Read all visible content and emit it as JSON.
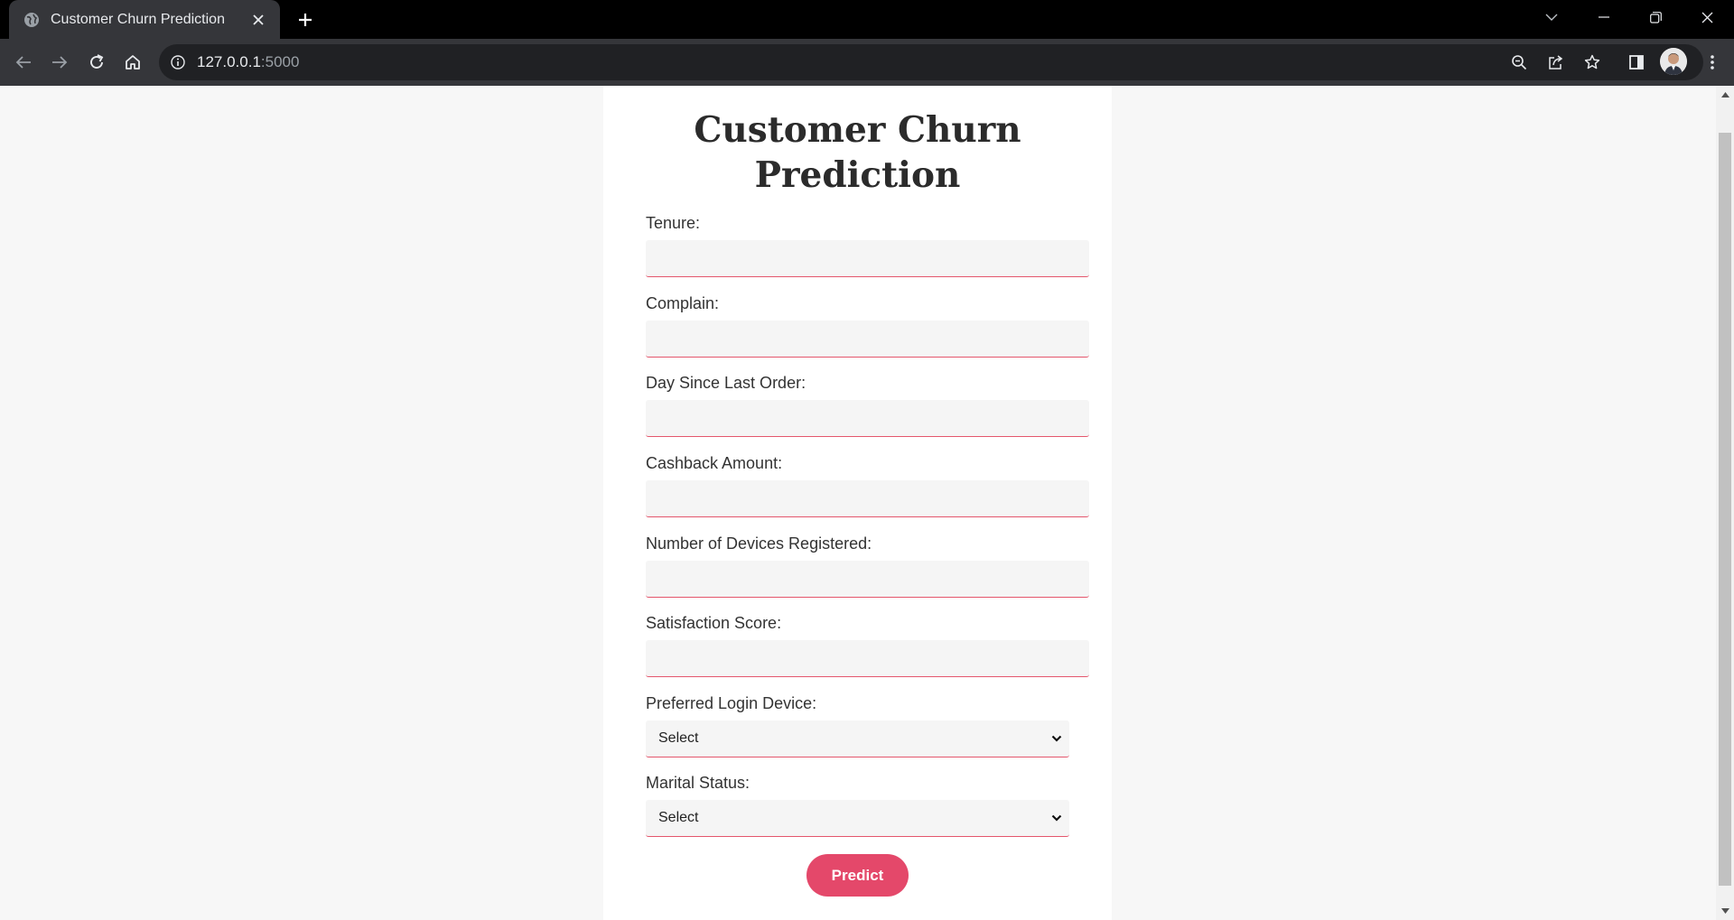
{
  "browser": {
    "tab_title": "Customer Churn Prediction",
    "url_host": "127.0.0.1",
    "url_port": ":5000"
  },
  "page": {
    "title_line1": "Customer Churn",
    "title_line2": "Prediction",
    "fields": [
      {
        "label": "Tenure:",
        "value": ""
      },
      {
        "label": "Complain:",
        "value": ""
      },
      {
        "label": "Day Since Last Order:",
        "value": ""
      },
      {
        "label": "Cashback Amount:",
        "value": ""
      },
      {
        "label": "Number of Devices Registered:",
        "value": ""
      },
      {
        "label": "Satisfaction Score:",
        "value": ""
      }
    ],
    "selects": [
      {
        "label": "Preferred Login Device:",
        "selected": "Select"
      },
      {
        "label": "Marital Status:",
        "selected": "Select"
      }
    ],
    "submit_label": "Predict"
  },
  "colors": {
    "accent": "#e4486a",
    "page_background": "#f7f7f7",
    "card_background": "#ffffff"
  },
  "icons": [
    "globe-icon",
    "close-icon",
    "plus-icon",
    "chevron-down-icon",
    "minimize-icon",
    "restore-icon",
    "back-arrow-icon",
    "forward-arrow-icon",
    "reload-icon",
    "home-icon",
    "info-icon",
    "zoom-icon",
    "share-icon",
    "star-icon",
    "side-panel-icon",
    "avatar"
  ]
}
